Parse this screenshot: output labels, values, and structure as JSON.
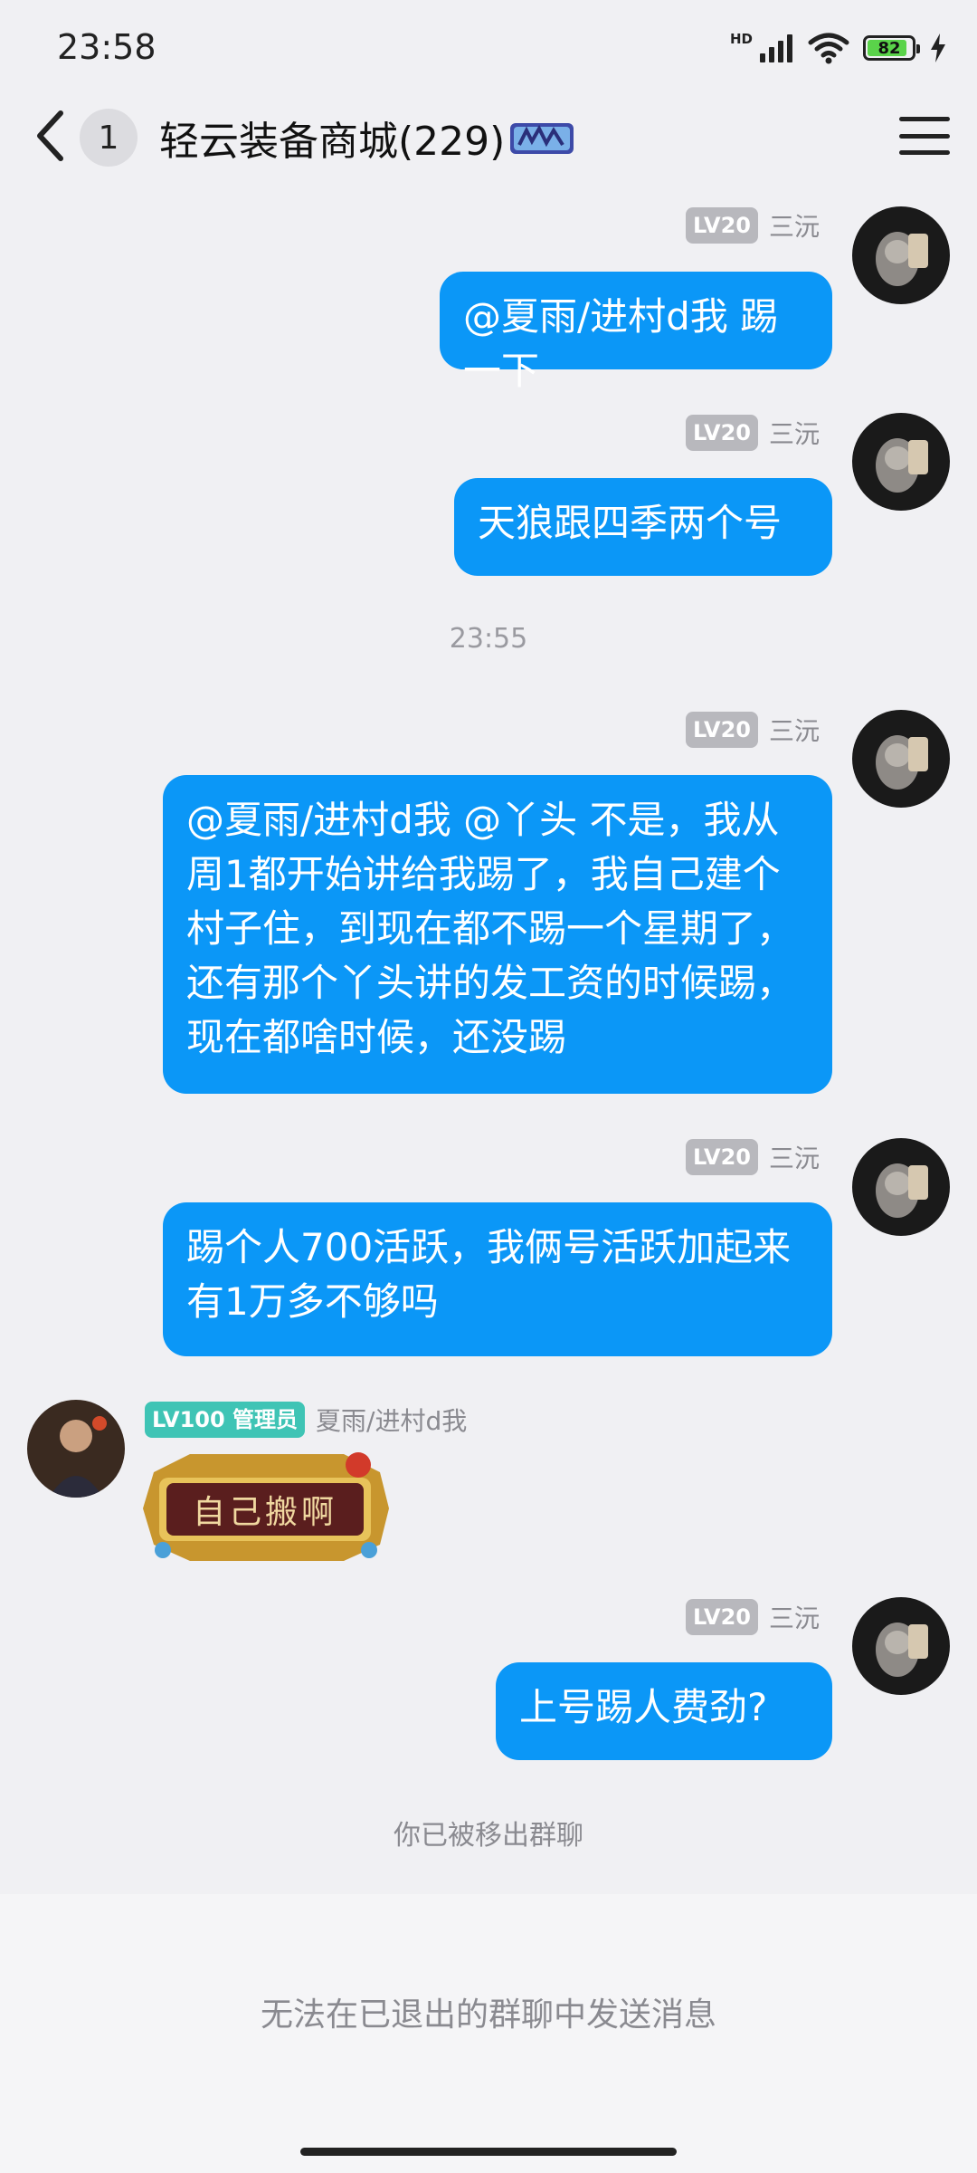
{
  "status_bar": {
    "time": "23:58",
    "hd_label": "HD",
    "battery_level": "82",
    "icons": [
      "signal-icon",
      "wifi-icon",
      "battery-icon",
      "charging-icon"
    ]
  },
  "header": {
    "unread_count": "1",
    "title": "轻云装备商城(229)",
    "icons": [
      "back-icon",
      "group-badge-icon",
      "menu-icon"
    ]
  },
  "messages": [
    {
      "level": "LV20",
      "nickname": "三沅",
      "text": "@夏雨/进村d我 踢一下"
    },
    {
      "level": "LV20",
      "nickname": "三沅",
      "text": "天狼跟四季两个号"
    },
    {
      "level": "LV20",
      "nickname": "三沅",
      "text": "@夏雨/进村d我 @丫头 不是，我从周1都开始讲给我踢了，我自己建个村子住，到现在都不踢一个星期了，还有那个丫头讲的发工资的时候踢，现在都啥时候，还没踢"
    },
    {
      "level": "LV20",
      "nickname": "三沅",
      "text": "踢个人700活跃，我俩号活跃加起来有1万多不够吗"
    },
    {
      "level": "LV20",
      "nickname": "三沅",
      "text": "上号踢人费劲?"
    }
  ],
  "time_divider": "23:55",
  "incoming": {
    "level": "LV100 管理员",
    "nickname": "夏雨/进村d我",
    "sticker_text": "自己搬啊"
  },
  "system_notice": "你已被移出群聊",
  "footer_notice": "无法在已退出的群聊中发送消息",
  "colors": {
    "bubble": "#0b97f7",
    "admin_badge": "#3fc4b5",
    "level_badge": "#b8b8bd",
    "background": "#f0f0f3"
  }
}
